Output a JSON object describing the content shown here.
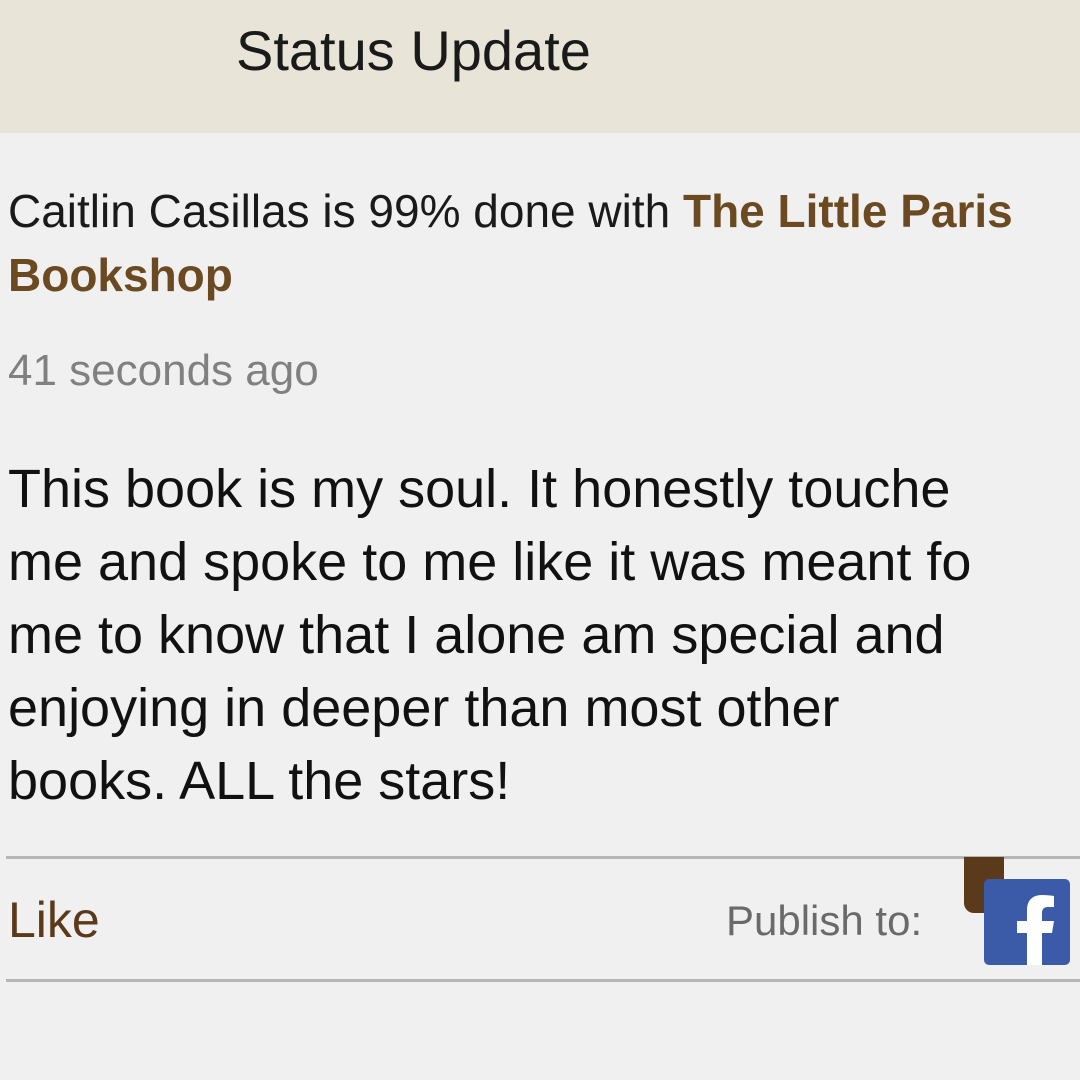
{
  "header": {
    "title": "Status Update"
  },
  "status": {
    "user_name": "Caitlin Casillas",
    "progress_text": " is 99% done with ",
    "progress_percent": 99,
    "book_title": "The Little Paris Bookshop",
    "timestamp": "41 seconds ago",
    "body_lines": [
      "This book is my soul. It honestly touche",
      "me and spoke to me like it was meant fo",
      "me to know that I alone am special and",
      "enjoying in deeper than most other",
      "books. ALL the stars!"
    ]
  },
  "actions": {
    "like_label": "Like",
    "publish_label": "Publish to:",
    "publish_target_icon": "facebook-icon"
  },
  "colors": {
    "header_bg": "#e8e4d8",
    "book_link": "#6b4a22",
    "like": "#5a3a1a",
    "facebook": "#3b5aa8"
  }
}
